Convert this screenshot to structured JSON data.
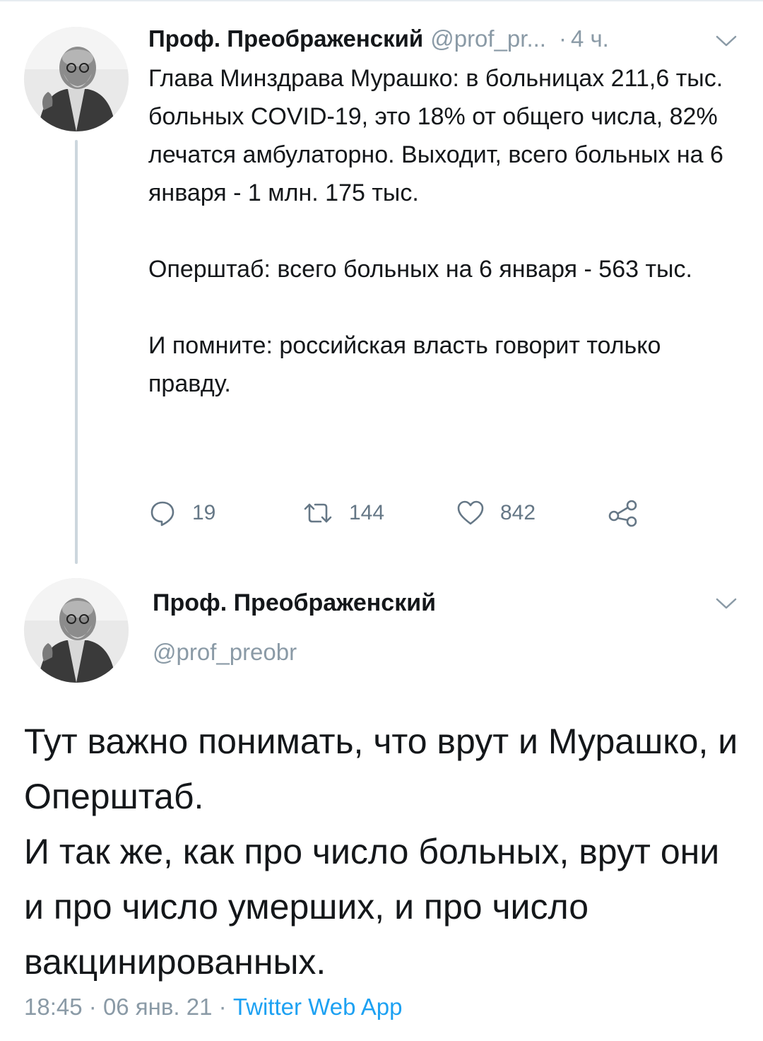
{
  "tweet1": {
    "author_name": "Проф. Преображенский",
    "handle": "@prof_pr...",
    "separator": "·",
    "time": "4 ч.",
    "paragraphs": [
      "Глава Минздрава Мурашко: в больницах 211,6 тыс. больных COVID-19, это 18% от общего числа, 82% лечатся амбулаторно. Выходит, всего больных на 6 января - 1 млн. 175 тыс.",
      "Оперштаб: всего больных на 6 января - 563 тыс.",
      "И помните: российская власть говорит только правду."
    ],
    "actions": {
      "replies": "19",
      "retweets": "144",
      "likes": "842"
    }
  },
  "tweet2": {
    "author_name": "Проф. Преображенский",
    "handle": "@prof_preobr",
    "paragraphs": [
      "Тут важно понимать, что врут и Мурашко, и Оперштаб.",
      "И так же, как про число больных, врут они и про число умерших, и про число вакцинированных."
    ],
    "time": "18:45",
    "date": "06 янв. 21",
    "separator": "·",
    "app": "Twitter Web App"
  },
  "icons": {
    "reply": "reply-icon",
    "retweet": "retweet-icon",
    "like": "heart-icon",
    "share": "share-icon",
    "menu": "chevron-down-icon"
  },
  "colors": {
    "text": "#14171a",
    "secondary": "#8a9aa6",
    "link": "#1da1f2",
    "thread_line": "#ccd6dd"
  }
}
